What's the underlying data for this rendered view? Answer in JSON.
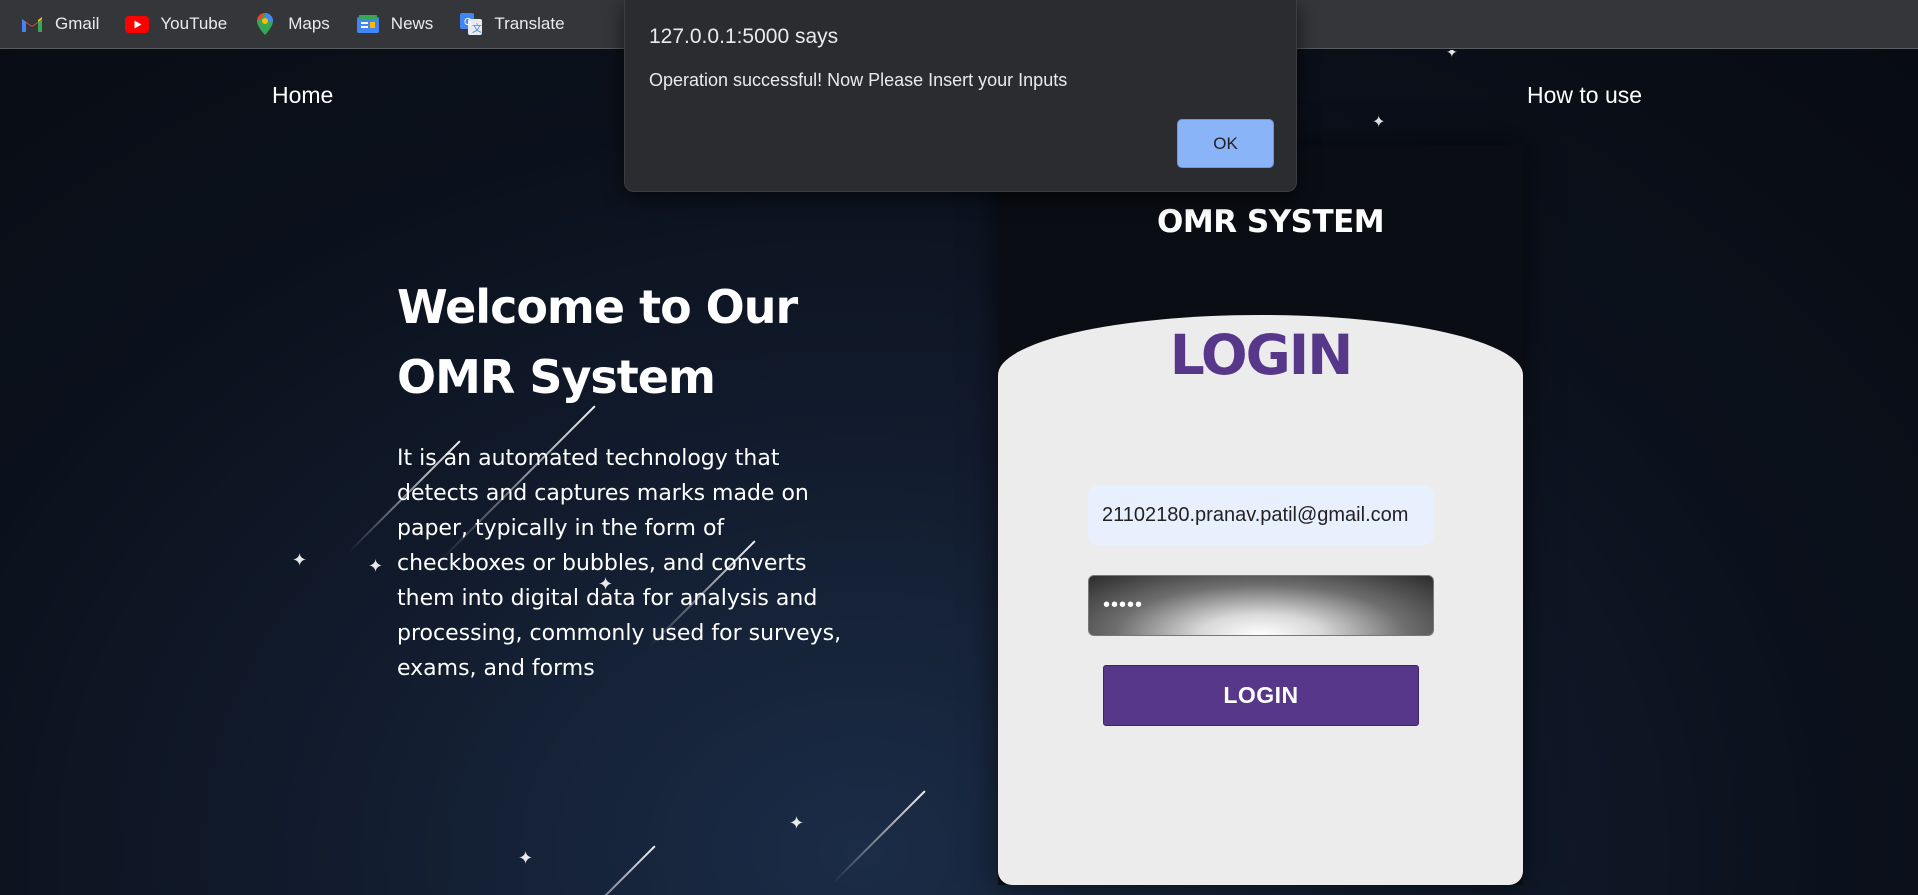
{
  "bookmarks": [
    {
      "label": "Gmail",
      "icon": "gmail-icon"
    },
    {
      "label": "YouTube",
      "icon": "youtube-icon"
    },
    {
      "label": "Maps",
      "icon": "maps-icon"
    },
    {
      "label": "News",
      "icon": "news-icon"
    },
    {
      "label": "Translate",
      "icon": "translate-icon"
    }
  ],
  "nav": {
    "home": "Home",
    "how_to_use": "How to use"
  },
  "hero": {
    "title": "Welcome to Our OMR System",
    "description": "It is an automated technology that detects and captures marks made on paper, typically in the form of checkboxes or bubbles, and converts them into digital data for analysis and processing, commonly used for surveys, exams, and forms"
  },
  "login": {
    "panel_title": "OMR SYSTEM",
    "heading": "LOGIN",
    "email_value": "21102180.pranav.patil@gmail.com",
    "password_value": "•••••",
    "button_label": "LOGIN"
  },
  "alert": {
    "origin": "127.0.0.1:5000 says",
    "message": "Operation successful! Now Please Insert your Inputs",
    "ok_label": "OK"
  },
  "colors": {
    "accent": "#57378a",
    "alert_button": "#8ab4f8",
    "bookmarks_bar": "#35363a"
  }
}
